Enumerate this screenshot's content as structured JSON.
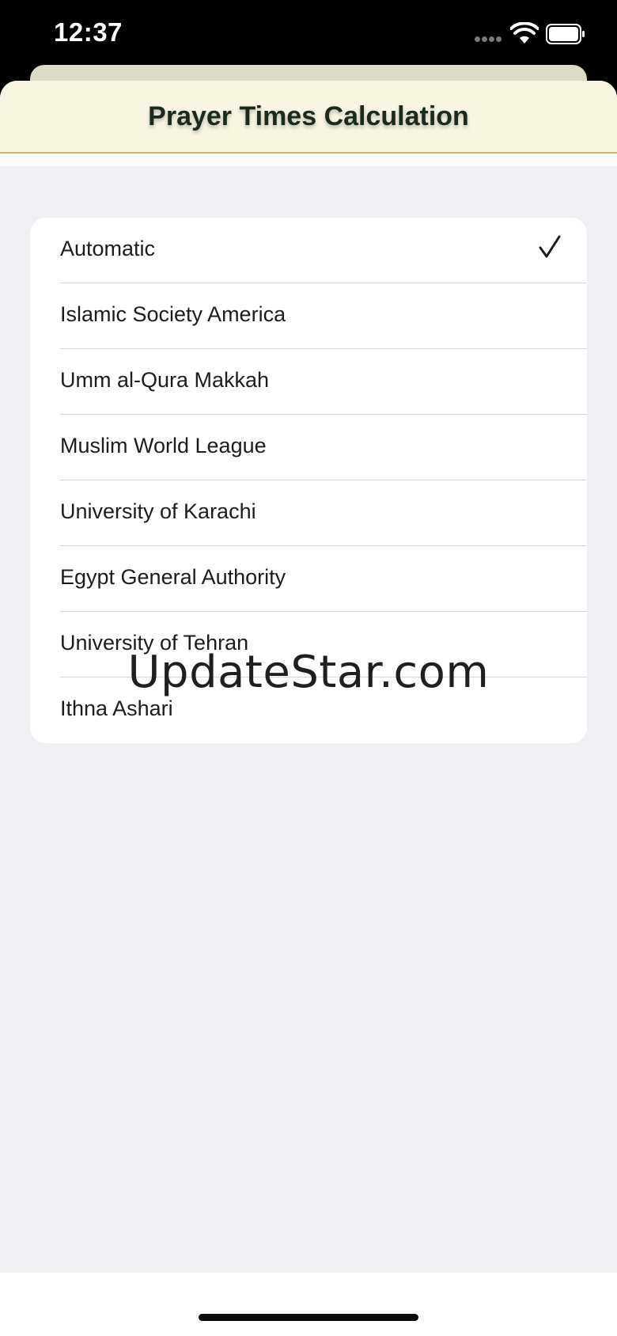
{
  "status_bar": {
    "time": "12:37",
    "icons": [
      "cellular-signal-icon",
      "wifi-icon",
      "battery-icon"
    ]
  },
  "header": {
    "title": "Prayer Times Calculation"
  },
  "methods": {
    "selected": "Automatic",
    "items": [
      {
        "label": "Automatic",
        "checked": true
      },
      {
        "label": "Islamic Society America",
        "checked": false
      },
      {
        "label": "Umm al-Qura Makkah",
        "checked": false
      },
      {
        "label": "Muslim World League",
        "checked": false
      },
      {
        "label": "University of Karachi",
        "checked": false
      },
      {
        "label": "Egypt General Authority",
        "checked": false
      },
      {
        "label": "University of Tehran",
        "checked": false
      },
      {
        "label": "Ithna Ashari",
        "checked": false
      }
    ]
  },
  "watermark": "UpdateStar.com",
  "colors": {
    "header_background": "#f8f6e2",
    "header_accent_line": "#d6b75a",
    "page_background": "#efeff4"
  }
}
